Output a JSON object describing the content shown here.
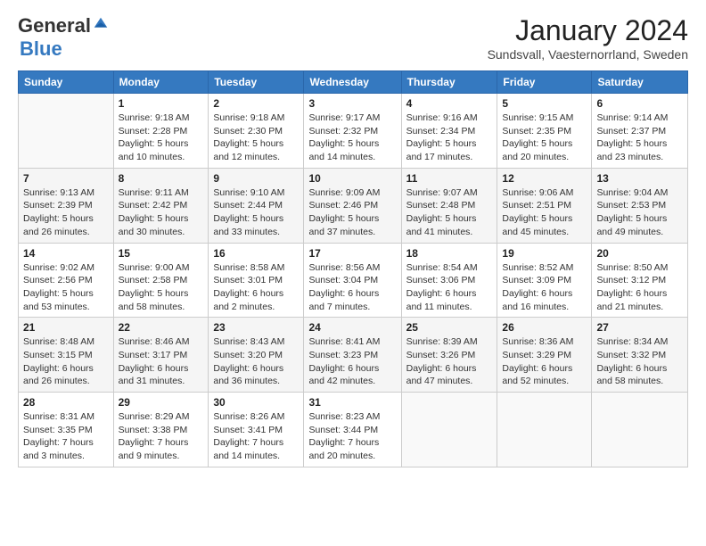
{
  "logo": {
    "general": "General",
    "blue": "Blue"
  },
  "header": {
    "title": "January 2024",
    "subtitle": "Sundsvall, Vaesternorrland, Sweden"
  },
  "days_of_week": [
    "Sunday",
    "Monday",
    "Tuesday",
    "Wednesday",
    "Thursday",
    "Friday",
    "Saturday"
  ],
  "weeks": [
    [
      {
        "num": "",
        "info": ""
      },
      {
        "num": "1",
        "info": "Sunrise: 9:18 AM\nSunset: 2:28 PM\nDaylight: 5 hours\nand 10 minutes."
      },
      {
        "num": "2",
        "info": "Sunrise: 9:18 AM\nSunset: 2:30 PM\nDaylight: 5 hours\nand 12 minutes."
      },
      {
        "num": "3",
        "info": "Sunrise: 9:17 AM\nSunset: 2:32 PM\nDaylight: 5 hours\nand 14 minutes."
      },
      {
        "num": "4",
        "info": "Sunrise: 9:16 AM\nSunset: 2:34 PM\nDaylight: 5 hours\nand 17 minutes."
      },
      {
        "num": "5",
        "info": "Sunrise: 9:15 AM\nSunset: 2:35 PM\nDaylight: 5 hours\nand 20 minutes."
      },
      {
        "num": "6",
        "info": "Sunrise: 9:14 AM\nSunset: 2:37 PM\nDaylight: 5 hours\nand 23 minutes."
      }
    ],
    [
      {
        "num": "7",
        "info": "Sunrise: 9:13 AM\nSunset: 2:39 PM\nDaylight: 5 hours\nand 26 minutes."
      },
      {
        "num": "8",
        "info": "Sunrise: 9:11 AM\nSunset: 2:42 PM\nDaylight: 5 hours\nand 30 minutes."
      },
      {
        "num": "9",
        "info": "Sunrise: 9:10 AM\nSunset: 2:44 PM\nDaylight: 5 hours\nand 33 minutes."
      },
      {
        "num": "10",
        "info": "Sunrise: 9:09 AM\nSunset: 2:46 PM\nDaylight: 5 hours\nand 37 minutes."
      },
      {
        "num": "11",
        "info": "Sunrise: 9:07 AM\nSunset: 2:48 PM\nDaylight: 5 hours\nand 41 minutes."
      },
      {
        "num": "12",
        "info": "Sunrise: 9:06 AM\nSunset: 2:51 PM\nDaylight: 5 hours\nand 45 minutes."
      },
      {
        "num": "13",
        "info": "Sunrise: 9:04 AM\nSunset: 2:53 PM\nDaylight: 5 hours\nand 49 minutes."
      }
    ],
    [
      {
        "num": "14",
        "info": "Sunrise: 9:02 AM\nSunset: 2:56 PM\nDaylight: 5 hours\nand 53 minutes."
      },
      {
        "num": "15",
        "info": "Sunrise: 9:00 AM\nSunset: 2:58 PM\nDaylight: 5 hours\nand 58 minutes."
      },
      {
        "num": "16",
        "info": "Sunrise: 8:58 AM\nSunset: 3:01 PM\nDaylight: 6 hours\nand 2 minutes."
      },
      {
        "num": "17",
        "info": "Sunrise: 8:56 AM\nSunset: 3:04 PM\nDaylight: 6 hours\nand 7 minutes."
      },
      {
        "num": "18",
        "info": "Sunrise: 8:54 AM\nSunset: 3:06 PM\nDaylight: 6 hours\nand 11 minutes."
      },
      {
        "num": "19",
        "info": "Sunrise: 8:52 AM\nSunset: 3:09 PM\nDaylight: 6 hours\nand 16 minutes."
      },
      {
        "num": "20",
        "info": "Sunrise: 8:50 AM\nSunset: 3:12 PM\nDaylight: 6 hours\nand 21 minutes."
      }
    ],
    [
      {
        "num": "21",
        "info": "Sunrise: 8:48 AM\nSunset: 3:15 PM\nDaylight: 6 hours\nand 26 minutes."
      },
      {
        "num": "22",
        "info": "Sunrise: 8:46 AM\nSunset: 3:17 PM\nDaylight: 6 hours\nand 31 minutes."
      },
      {
        "num": "23",
        "info": "Sunrise: 8:43 AM\nSunset: 3:20 PM\nDaylight: 6 hours\nand 36 minutes."
      },
      {
        "num": "24",
        "info": "Sunrise: 8:41 AM\nSunset: 3:23 PM\nDaylight: 6 hours\nand 42 minutes."
      },
      {
        "num": "25",
        "info": "Sunrise: 8:39 AM\nSunset: 3:26 PM\nDaylight: 6 hours\nand 47 minutes."
      },
      {
        "num": "26",
        "info": "Sunrise: 8:36 AM\nSunset: 3:29 PM\nDaylight: 6 hours\nand 52 minutes."
      },
      {
        "num": "27",
        "info": "Sunrise: 8:34 AM\nSunset: 3:32 PM\nDaylight: 6 hours\nand 58 minutes."
      }
    ],
    [
      {
        "num": "28",
        "info": "Sunrise: 8:31 AM\nSunset: 3:35 PM\nDaylight: 7 hours\nand 3 minutes."
      },
      {
        "num": "29",
        "info": "Sunrise: 8:29 AM\nSunset: 3:38 PM\nDaylight: 7 hours\nand 9 minutes."
      },
      {
        "num": "30",
        "info": "Sunrise: 8:26 AM\nSunset: 3:41 PM\nDaylight: 7 hours\nand 14 minutes."
      },
      {
        "num": "31",
        "info": "Sunrise: 8:23 AM\nSunset: 3:44 PM\nDaylight: 7 hours\nand 20 minutes."
      },
      {
        "num": "",
        "info": ""
      },
      {
        "num": "",
        "info": ""
      },
      {
        "num": "",
        "info": ""
      }
    ]
  ]
}
